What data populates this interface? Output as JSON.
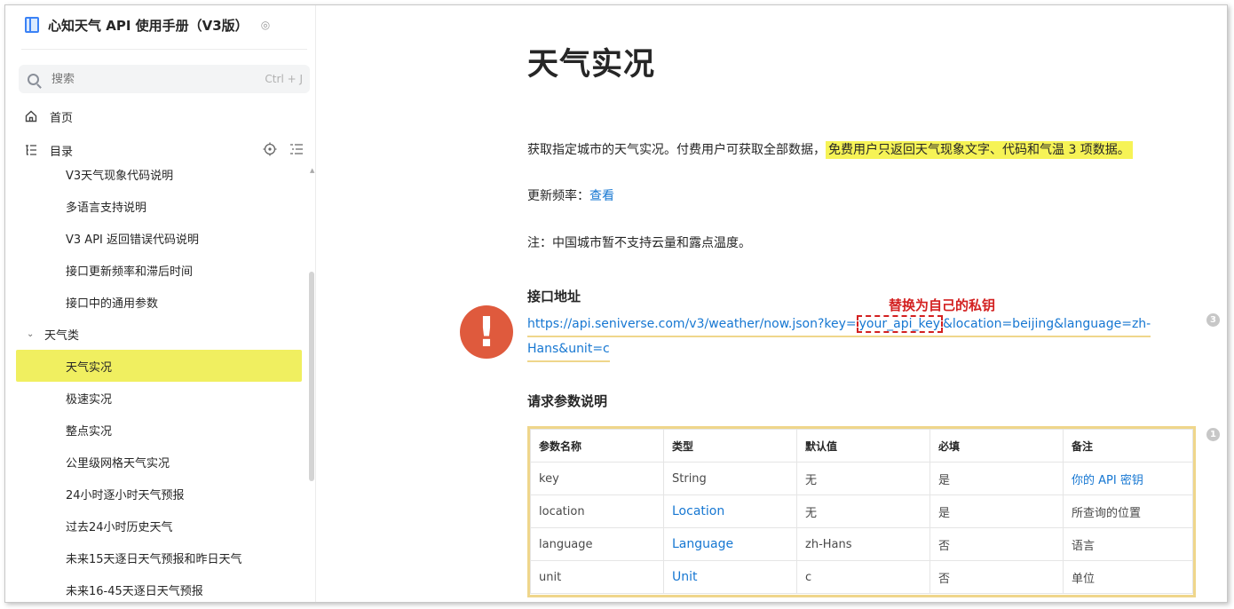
{
  "sidebar": {
    "book_title": "心知天气 API 使用手册（V3版）",
    "book_title_extra": "◎",
    "search_placeholder": "搜索",
    "search_shortcut": "Ctrl + J",
    "home_label": "首页",
    "toc_label": "目录",
    "toc_items": [
      {
        "label": "V3天气现象代码说明",
        "kind": "item"
      },
      {
        "label": "多语言支持说明",
        "kind": "item"
      },
      {
        "label": "V3 API 返回错误代码说明",
        "kind": "item"
      },
      {
        "label": "接口更新频率和滞后时间",
        "kind": "item"
      },
      {
        "label": "接口中的通用参数",
        "kind": "item"
      },
      {
        "label": "天气类",
        "kind": "group"
      },
      {
        "label": "天气实况",
        "kind": "active"
      },
      {
        "label": "极速实况",
        "kind": "item"
      },
      {
        "label": "整点实况",
        "kind": "item"
      },
      {
        "label": "公里级网格天气实况",
        "kind": "item"
      },
      {
        "label": "24小时逐小时天气预报",
        "kind": "item"
      },
      {
        "label": "过去24小时历史天气",
        "kind": "item"
      },
      {
        "label": "未来15天逐日天气预报和昨日天气",
        "kind": "item"
      },
      {
        "label": "未来16-45天逐日天气预报",
        "kind": "item"
      }
    ]
  },
  "main": {
    "title": "天气实况",
    "intro_plain": "获取指定城市的天气实况。付费用户可获取全部数据，",
    "intro_highlight": "免费用户只返回天气现象文字、代码和气温 3 项数据。",
    "update_label": "更新频率：",
    "update_link": "查看",
    "note": "注：中国城市暂不支持云量和露点温度。",
    "api_heading": "接口地址",
    "annotation": "替换为自己的私钥",
    "url_part1": "https://api.seniverse.com/v3/weather/now.json?key=",
    "url_key": "your_api_key",
    "url_part2": "&location=beijing&language=zh-",
    "url_line2": "Hans&unit=c",
    "warning_symbol": "!",
    "url_comment_count": "3",
    "params_heading": "请求参数说明",
    "table_comment_count": "1",
    "table": {
      "headers": [
        "参数名称",
        "类型",
        "默认值",
        "必填",
        "备注"
      ],
      "rows": [
        [
          "key",
          "String",
          "无",
          "是",
          "你的 API 密钥"
        ],
        [
          "location",
          "Location",
          "无",
          "是",
          "所查询的位置"
        ],
        [
          "language",
          "Language",
          "zh-Hans",
          "否",
          "语言"
        ],
        [
          "unit",
          "Unit",
          "c",
          "否",
          "单位"
        ]
      ]
    }
  },
  "colors": {
    "highlight": "#f6f356",
    "link": "#1677d2",
    "annotation_red": "#d32020",
    "warning_orange": "#df5a3d",
    "frame_gold": "#efd68b"
  }
}
